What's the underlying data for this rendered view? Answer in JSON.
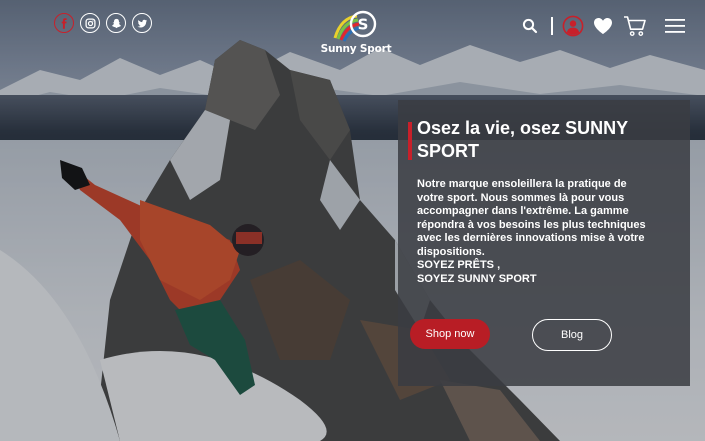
{
  "header": {
    "socials": [
      {
        "icon": "facebook-icon"
      },
      {
        "icon": "instagram-icon"
      },
      {
        "icon": "snapchat-icon"
      },
      {
        "icon": "twitter-icon"
      }
    ],
    "logo_text": "Sunny Sport",
    "right_icons": [
      "search-icon",
      "user-icon",
      "heart-icon",
      "cart-icon",
      "menu-icon"
    ]
  },
  "hero": {
    "headline": "Osez la vie, osez SUNNY SPORT",
    "body_lines": [
      "Notre marque ensoleillera la pratique de",
      "votre sport. Nous sommes  là pour vous",
      "accompagner dans l'extrême. La gamme",
      "répondra à vos besoins les plus techniques",
      "avec les dernières innovations mise à votre",
      "dispositions.",
      "SOYEZ PRÊTS  ,",
      "SOYEZ SUNNY SPORT"
    ],
    "primary_button": "Shop now",
    "secondary_button": "Blog"
  },
  "colors": {
    "accent": "#c8202a",
    "button_primary": "#b81d25",
    "panel": "#3a3c42",
    "text": "#ffffff"
  }
}
